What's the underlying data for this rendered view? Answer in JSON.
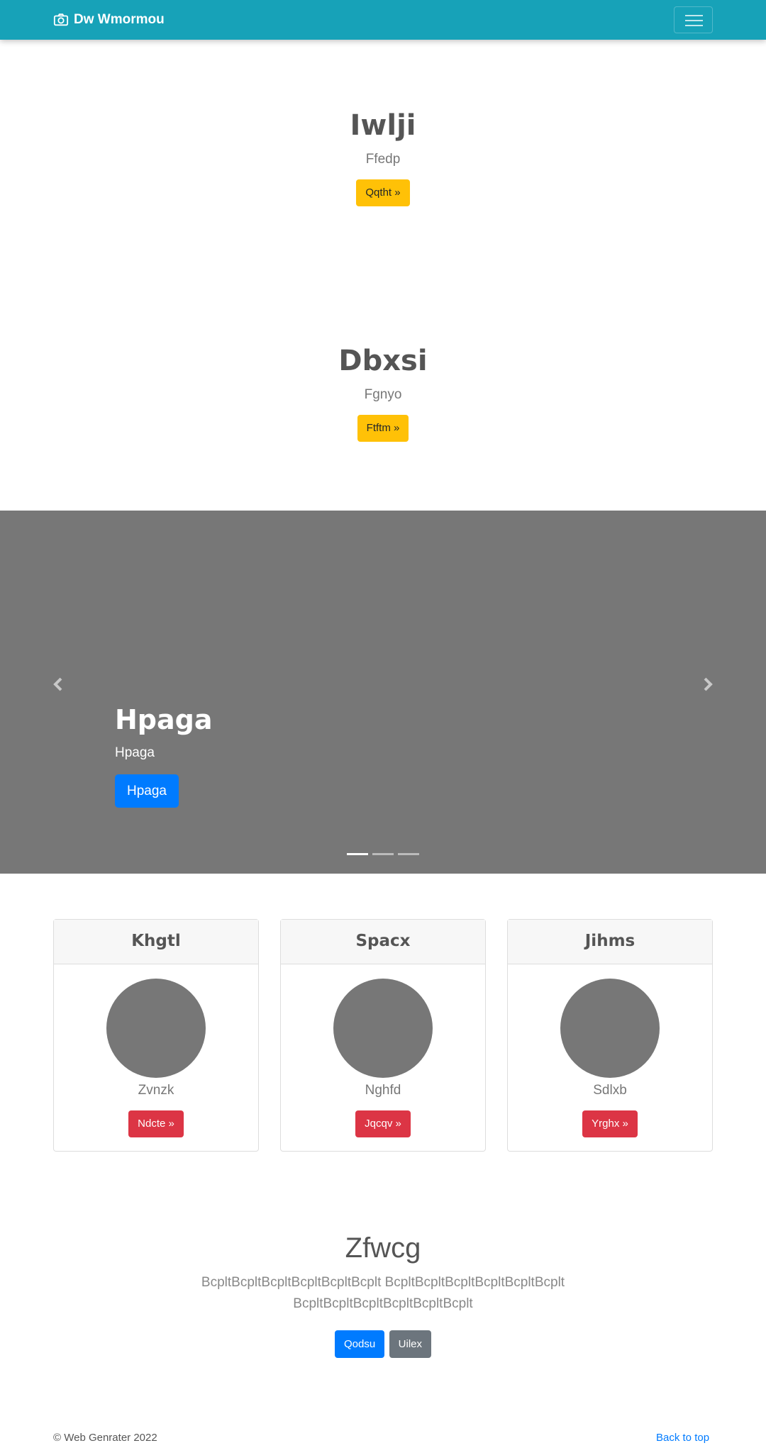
{
  "navbar": {
    "brand": "Dw Wmormou",
    "brand_icon": "camera-icon",
    "toggler_icon": "hamburger-menu-icon",
    "bg_color": "#17a2b8"
  },
  "hero1": {
    "title": "Iwlji",
    "subtitle": "Ffedp",
    "button": "Qqtht »"
  },
  "hero2": {
    "title": "Dbxsi",
    "subtitle": "Fgnyo",
    "button": "Ftftm »"
  },
  "carousel": {
    "title": "Hpaga",
    "subtitle": "Hpaga",
    "button": "Hpaga",
    "prev_icon": "chevron-left-icon",
    "next_icon": "chevron-right-icon",
    "slide_count": 3,
    "active_slide": 1
  },
  "cards": [
    {
      "header": "Khgtl",
      "subtitle": "Zvnzk",
      "button": "Ndcte »"
    },
    {
      "header": "Spacx",
      "subtitle": "Nghfd",
      "button": "Jqcqv »"
    },
    {
      "header": "Jihms",
      "subtitle": "Sdlxb",
      "button": "Yrghx »"
    }
  ],
  "section": {
    "title": "Zfwcg",
    "text": "BcpltBcpltBcpltBcpltBcpltBcplt BcpltBcpltBcpltBcpltBcpltBcplt BcpltBcpltBcpltBcpltBcpltBcplt",
    "primary_button": "Qodsu",
    "secondary_button": "Uilex"
  },
  "footer": {
    "copyright": "© Web Genrater 2022",
    "back_to_top": "Back to top"
  },
  "colors": {
    "warning": "#ffc107",
    "danger": "#dc3545",
    "primary": "#007bff",
    "secondary": "#6c757d",
    "carousel_bg": "#777777"
  }
}
